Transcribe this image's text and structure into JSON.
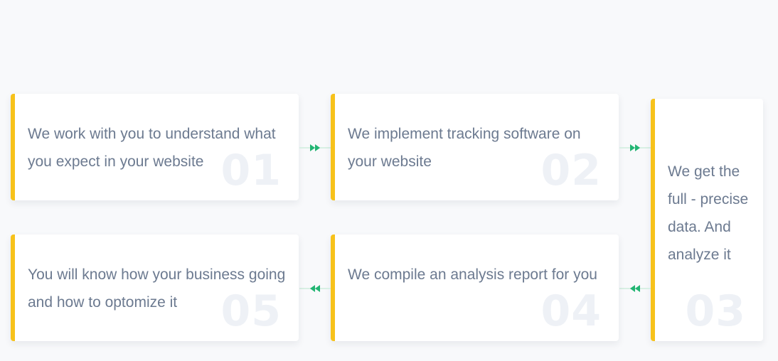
{
  "accent_color": "#f7c21b",
  "arrow_color": "#22b573",
  "steps": [
    {
      "number": "01",
      "text": "We work with you to understand what you expect in your website"
    },
    {
      "number": "02",
      "text": "We implement tracking software on your website"
    },
    {
      "number": "03",
      "text": "We get the full - precise data. And analyze it"
    },
    {
      "number": "04",
      "text": "We compile an analysis report for you"
    },
    {
      "number": "05",
      "text": "You will know how your business going and how to optomize it"
    }
  ],
  "connectors": [
    {
      "from": "01",
      "to": "02",
      "direction": "right",
      "icon": "double-chevron-right-icon"
    },
    {
      "from": "02",
      "to": "03",
      "direction": "right",
      "icon": "double-chevron-right-icon"
    },
    {
      "from": "03",
      "to": "04",
      "direction": "left",
      "icon": "double-chevron-left-icon"
    },
    {
      "from": "04",
      "to": "05",
      "direction": "left",
      "icon": "double-chevron-left-icon"
    }
  ]
}
